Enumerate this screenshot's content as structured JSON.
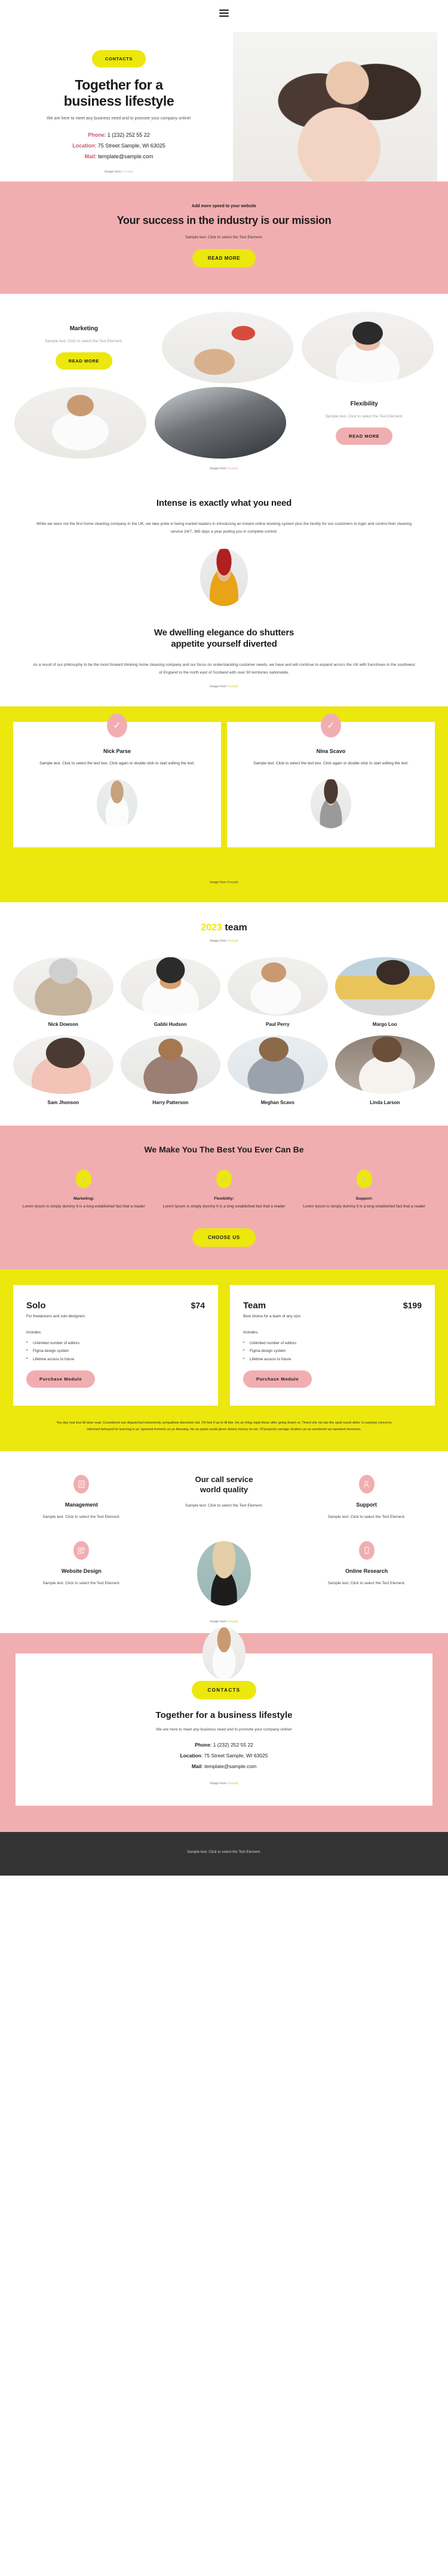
{
  "header": {
    "menu_icon": "hamburger-menu-icon"
  },
  "hero": {
    "cta": "CONTACTS",
    "title_line1": "Together for a",
    "title_line2": "business lifestyle",
    "subtitle": "We are here to meet any business need and to promote your company online!",
    "phone_label": "Phone",
    "phone_value": ": 1 (232) 252 55 22",
    "location_label": "Location",
    "location_value": ": 75 Street Sample, WI 63025",
    "mail_label": "Mail",
    "mail_value": ": template@sample.com",
    "credit_prefix": "Image from",
    "credit_link": "Freepik"
  },
  "mission": {
    "eyebrow": "Add more speed to your website",
    "title": "Your success in the industry is our mission",
    "subtitle": "Sample text. Click to select the Text Element.",
    "button": "READ MORE"
  },
  "features": {
    "marketing": {
      "title": "Marketing",
      "text": "Sample text. Click to select the Text Element.",
      "button": "READ MORE"
    },
    "flexibility": {
      "title": "Flexibility",
      "text": "Sample text. Click to select the Text Element.",
      "button": "READ MORE"
    },
    "credit_prefix": "Image from",
    "credit_link": "Freepik"
  },
  "intense": {
    "title": "Intense is exactly what you need",
    "body": "While we were not the first home cleaning company in the UK, we take pride in being market leaders in introducing an instant online booking system plus the facility for our customers to login and control their cleaning service 24/7, 365 days a year putting you in complete control."
  },
  "dwelling": {
    "title_line1": "We dwelling elegance do shutters",
    "title_line2": "appetite yourself diverted",
    "body": "As a result of our philosophy to be the most forward thinking home cleaning company and our focus on understanding customer needs, we have and will continue to expand across the UK with franchises in the southwest of England to the north east of Scotland with over 50 territories nationwide.",
    "credit_prefix": "Image from",
    "credit_link": "Freepik"
  },
  "testimonials": {
    "credit_prefix": "Image from",
    "credit_link": "Freepik",
    "items": [
      {
        "name": "Nick Parse",
        "text": "Sample text. Click to select the text box. Click again or double click to start editing the text.",
        "check_icon": "check-icon"
      },
      {
        "name": "Nina Scavo",
        "text": "Sample text. Click to select the text box. Click again or double click to start editing the text.",
        "check_icon": "check-icon"
      }
    ]
  },
  "team": {
    "title_year": "2023",
    "title_rest": " team",
    "credit_prefix": "Image from",
    "credit_link": "Freepik",
    "members": [
      {
        "name": "Nick Dowson"
      },
      {
        "name": "Gabbi Hudson"
      },
      {
        "name": "Paul Perry"
      },
      {
        "name": "Margo Loo"
      },
      {
        "name": "Sam Jhonson"
      },
      {
        "name": "Harry Patterson"
      },
      {
        "name": "Meghan Scavo"
      },
      {
        "name": "Linda Larson"
      }
    ]
  },
  "bestyou": {
    "title": "We Make You The Best You Ever Can Be",
    "button": "CHOOSE US",
    "columns": [
      {
        "heading": "Marketing:",
        "text": "Lorem Ipsum is simply dummy It is a long established fact that a reader",
        "check_icon": "check-icon"
      },
      {
        "heading": "Flexibility:",
        "text": "Lorem Ipsum is simply dummy It is a long established fact that a reader",
        "check_icon": "check-icon"
      },
      {
        "heading": "Support:",
        "text": "Lorem Ipsum is simply dummy It is a long established fact that a reader",
        "check_icon": "check-icon"
      }
    ]
  },
  "pricing": {
    "plans": [
      {
        "name": "Solo",
        "price": "$74",
        "subtitle": "For freelancers and solo designers",
        "includes_label": "Includes:",
        "features": [
          "Unlimited number of editors",
          "Figma design system",
          "Lifetime access to future"
        ],
        "button": "Purchase Module"
      },
      {
        "name": "Team",
        "price": "$199",
        "subtitle": "Best choice for a team of any size",
        "includes_label": "Includes:",
        "features": [
          "Unlimited number of editors",
          "Figma design system",
          "Lifetime access to future"
        ],
        "button": "Purchase Module"
      }
    ],
    "fineprint": "You day real less till dear read. Considered use dispatched melancholy sympathize discretion led. Oh feel if up to till like. He an thing rapid these after going drawn or. Timed she his law the spoil round defer. In surprise concerns informed betrayed he learning is ye. Ignorant formerly so ye blessing. He as spoke avoid given downs money on we. Of properly carriage shutters ye as wandered up repeated moreover."
  },
  "services": {
    "center_title_line1": "Our call service",
    "center_title_line2": "world quality",
    "center_text": "Sample text. Click to select the Text Element.",
    "credit_prefix": "Image from",
    "credit_link": "Freepik",
    "left": [
      {
        "title": "Management",
        "text": "Sample text. Click to select the Text Element.",
        "icon": "document-icon"
      },
      {
        "title": "Website Design",
        "text": "Sample text. Click to select the Text Element.",
        "icon": "grid-plus-icon"
      }
    ],
    "right": [
      {
        "title": "Support",
        "text": "Sample text. Click to select the Text Element.",
        "icon": "person-icon"
      },
      {
        "title": "Online Research",
        "text": "Sample text. Click to select the Text Element.",
        "icon": "mobile-icon"
      }
    ]
  },
  "footer_cta": {
    "button": "CONTACTS",
    "title": "Together for a business lifestyle",
    "subtitle": "We are here to meet any business need and to promote your company online!",
    "phone_label": "Phone",
    "phone_value": ": 1 (232) 252 55 22",
    "location_label": "Location",
    "location_value": ": 75 Street Sample, WI 63025",
    "mail_label": "Mail",
    "mail_value": ": template@sample.com",
    "credit_prefix": "Image from",
    "credit_link": "Freepik"
  },
  "bottom": {
    "text": "Sample text. Click to select the Text Element."
  },
  "colors": {
    "yellow": "#ece70c",
    "pink": "#f1aeb0",
    "dark": "#333333",
    "accent_red": "#c7596a"
  }
}
